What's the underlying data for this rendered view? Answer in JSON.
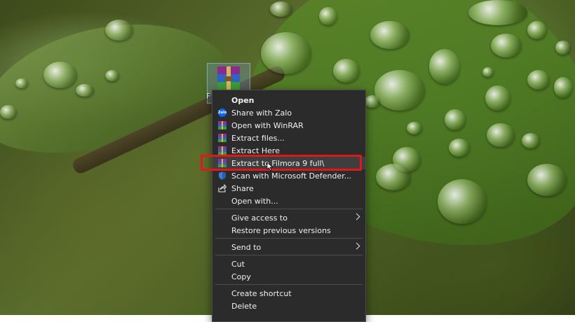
{
  "desktop": {
    "file_name_fragment": "F"
  },
  "context_menu": {
    "items": [
      {
        "label": "Open",
        "icon": "none",
        "bold": true
      },
      {
        "label": "Share with Zalo",
        "icon": "zalo-icon",
        "icon_text": "Zalo"
      },
      {
        "label": "Open with WinRAR",
        "icon": "winrar-icon"
      },
      {
        "label": "Extract files...",
        "icon": "winrar-icon"
      },
      {
        "label": "Extract Here",
        "icon": "winrar-icon"
      },
      {
        "label": "Extract to Filmora 9 full\\",
        "icon": "winrar-icon",
        "highlighted": true
      },
      {
        "label": "Scan with Microsoft Defender...",
        "icon": "defender-shield-icon"
      },
      {
        "label": "Share",
        "icon": "share-icon"
      },
      {
        "label": "Open with...",
        "icon": "none"
      },
      {
        "label": "Give access to",
        "icon": "none",
        "submenu": true
      },
      {
        "label": "Restore previous versions",
        "icon": "none"
      },
      {
        "label": "Send to",
        "icon": "none",
        "submenu": true
      },
      {
        "label": "Cut",
        "icon": "none"
      },
      {
        "label": "Copy",
        "icon": "none"
      },
      {
        "label": "Create shortcut",
        "icon": "none"
      },
      {
        "label": "Delete",
        "icon": "none"
      }
    ]
  },
  "colors": {
    "menu_background": "#2b2b2b",
    "highlight_border": "#e4161c",
    "zalo_blue": "#0a68ff"
  }
}
